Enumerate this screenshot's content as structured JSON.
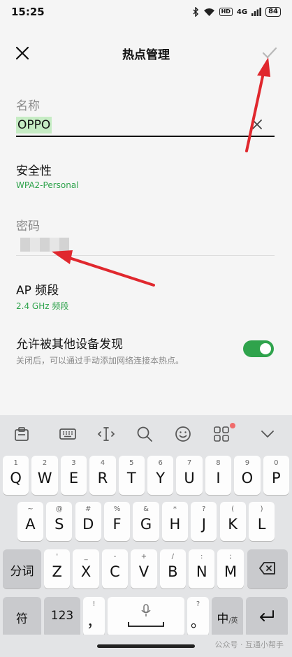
{
  "status": {
    "time": "15:25",
    "network": "4G",
    "hd": "HD",
    "battery": "84"
  },
  "header": {
    "title": "热点管理"
  },
  "name_field": {
    "label": "名称",
    "value": "OPPO"
  },
  "security": {
    "title": "安全性",
    "value": "WPA2-Personal"
  },
  "password": {
    "label": "密码"
  },
  "band": {
    "title": "AP 频段",
    "value": "2.4 GHz 频段"
  },
  "discoverable": {
    "title": "允许被其他设备发现",
    "desc": "关闭后，可以通过手动添加网络连接本热点。",
    "enabled": true
  },
  "keyboard": {
    "row1": [
      {
        "main": "Q",
        "alt": "1"
      },
      {
        "main": "W",
        "alt": "2"
      },
      {
        "main": "E",
        "alt": "3"
      },
      {
        "main": "R",
        "alt": "4"
      },
      {
        "main": "T",
        "alt": "5"
      },
      {
        "main": "Y",
        "alt": "6"
      },
      {
        "main": "U",
        "alt": "7"
      },
      {
        "main": "I",
        "alt": "8"
      },
      {
        "main": "O",
        "alt": "9"
      },
      {
        "main": "P",
        "alt": "0"
      }
    ],
    "row2": [
      {
        "main": "A",
        "alt": "~"
      },
      {
        "main": "S",
        "alt": "@"
      },
      {
        "main": "D",
        "alt": "#"
      },
      {
        "main": "F",
        "alt": "%"
      },
      {
        "main": "G",
        "alt": "&"
      },
      {
        "main": "H",
        "alt": "*"
      },
      {
        "main": "J",
        "alt": "?"
      },
      {
        "main": "K",
        "alt": "("
      },
      {
        "main": "L",
        "alt": ")"
      }
    ],
    "row3": [
      {
        "main": "Z",
        "alt": "'"
      },
      {
        "main": "X",
        "alt": "_"
      },
      {
        "main": "C",
        "alt": "-"
      },
      {
        "main": "V",
        "alt": "+"
      },
      {
        "main": "B",
        "alt": "/"
      },
      {
        "main": "N",
        "alt": ":"
      },
      {
        "main": "M",
        "alt": ";"
      }
    ],
    "split_label": "分词",
    "symbol_label": "符",
    "number_label": "123",
    "comma": "，",
    "comma_alt": "!",
    "period": "。",
    "period_alt": "?",
    "lang_main": "中",
    "lang_sub": "/英"
  },
  "watermark": "公众号 · 互通小帮手"
}
